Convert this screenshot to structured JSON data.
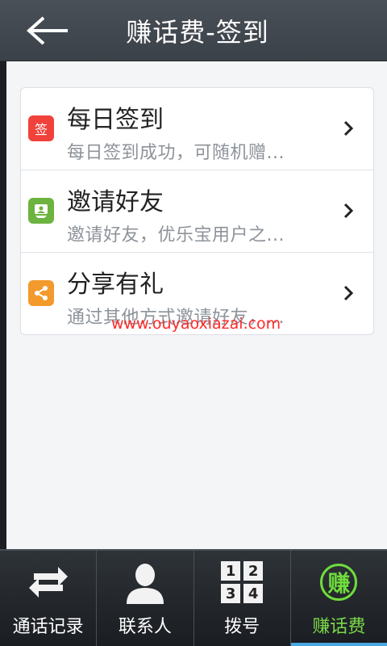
{
  "header": {
    "title": "赚话费-签到",
    "back_icon": "arrow-left-icon"
  },
  "list": {
    "items": [
      {
        "title": "每日签到",
        "subtitle": "每日签到成功，可随机赠...",
        "icon": "sign-in-icon",
        "icon_text": "签",
        "icon_color": "#f0413a"
      },
      {
        "title": "邀请好友",
        "subtitle": "邀请好友，优乐宝用户之...",
        "icon": "invite-friend-icon",
        "icon_color": "#6db33f"
      },
      {
        "title": "分享有礼",
        "subtitle": "通过其他方式邀请好友，...",
        "icon": "share-icon",
        "icon_color": "#f39a2c"
      }
    ]
  },
  "watermark": "www.ouyaoxiazai.com",
  "tabs": [
    {
      "label": "通话记录",
      "icon": "call-log-icon",
      "active": false
    },
    {
      "label": "联系人",
      "icon": "contacts-icon",
      "active": false
    },
    {
      "label": "拨号",
      "icon": "dialpad-icon",
      "keys": [
        "1",
        "2",
        "3",
        "4"
      ],
      "active": false
    },
    {
      "label": "赚话费",
      "icon": "earn-icon",
      "icon_text": "赚",
      "active": true
    }
  ],
  "colors": {
    "header_bg": "#3f454c",
    "active_tab_text": "#7bd84a",
    "active_tab_indicator": "#49a6e0",
    "watermark": "#ff2a2a"
  }
}
